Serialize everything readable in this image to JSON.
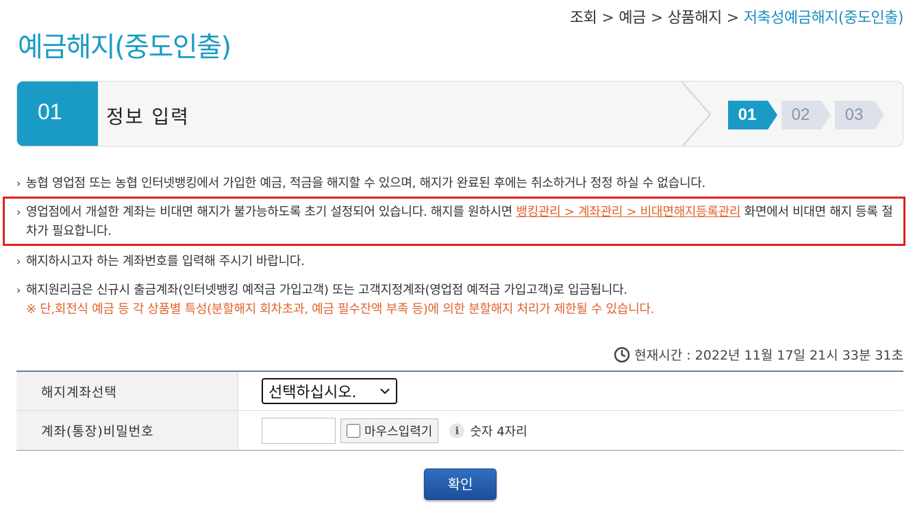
{
  "breadcrumb": {
    "items": [
      "조회",
      "예금",
      "상품해지"
    ],
    "current": "저축성예금해지(중도인출)",
    "separator": ">"
  },
  "page_title": "예금해지(중도인출)",
  "stepbar": {
    "current_number": "01",
    "current_title": "정보 입력",
    "steps": [
      "01",
      "02",
      "03"
    ],
    "active_step_index": 0
  },
  "notices": {
    "n1": "농협 영업점 또는 농협 인터넷뱅킹에서 가입한 예금, 적금을 해지할 수 있으며, 해지가 완료된 후에는 취소하거나 정정 하실 수 없습니다.",
    "n2_pre": "영업점에서 개설한 계좌는 비대면 해지가 불가능하도록 초기 설정되어 있습니다. 해지를 원하시면 ",
    "n2_link": "뱅킹관리 > 계좌관리 > 비대면해지등록관리",
    "n2_post": " 화면에서 비대면 해지 등록 절차가 필요합니다.",
    "n3": "해지하시고자 하는 계좌번호를 입력해 주시기 바랍니다.",
    "n4": "해지원리금은 신규시 출금계좌(인터넷뱅킹 예적금 가입고객) 또는 고객지정계좌(영업점 예적금 가입고객)로 입금됩니다.",
    "n4_note": "※ 단,회전식 예금 등 각 상품별 특성(분할해지 회차초과, 예금 필수잔액 부족 등)에 의한 분할해지 처리가 제한될 수 있습니다."
  },
  "clock": {
    "icon": "clock-icon",
    "label": "현재시간 : 2022년 11월 17일 21시 33분 31초"
  },
  "form": {
    "account_label": "해지계좌선택",
    "account_select_value": "선택하십시오.",
    "password_label": "계좌(통장)비밀번호",
    "password_value": "",
    "mouse_input_label": "마우스입력기",
    "hint_icon": "info-icon",
    "hint": "숫자 4자리"
  },
  "confirm_label": "확인",
  "colors": {
    "accent": "#1a9bc6",
    "link": "#e0622a",
    "highlight_border": "#e02020",
    "button": "#1d4f9a"
  }
}
